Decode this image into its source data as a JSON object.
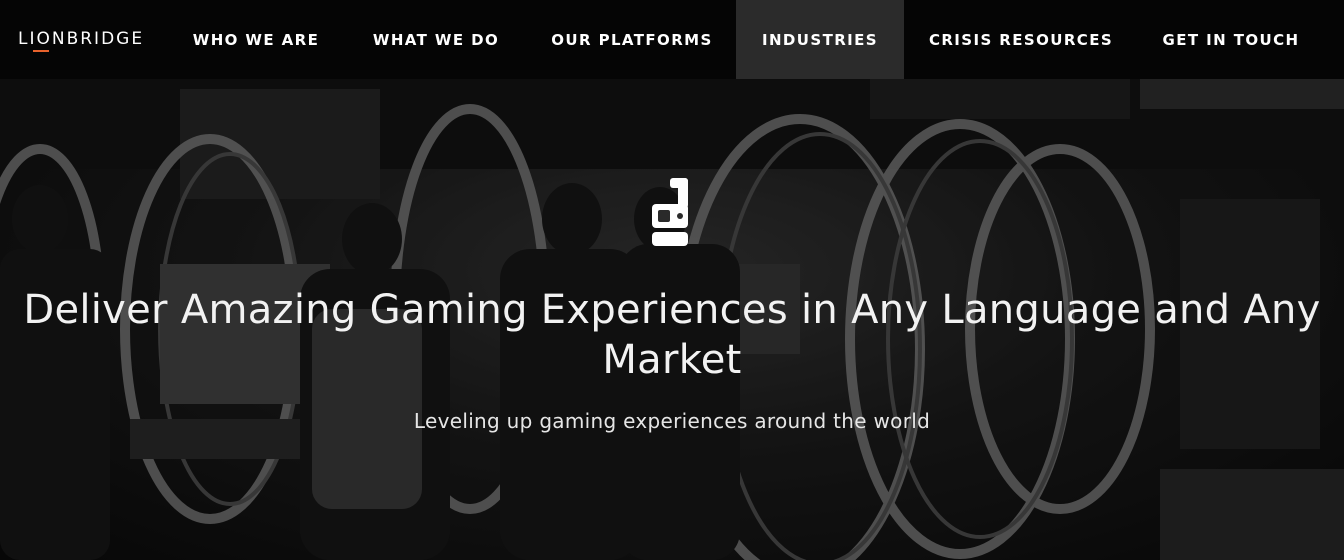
{
  "brand": {
    "logo_text": "LIONBRIDGE",
    "accent_color": "#e8622c"
  },
  "nav": {
    "items": [
      {
        "label": "WHO WE ARE"
      },
      {
        "label": "WHAT WE DO"
      },
      {
        "label": "OUR PLATFORMS"
      },
      {
        "label": "INDUSTRIES",
        "active": true
      },
      {
        "label": "CRISIS RESOURCES"
      },
      {
        "label": "GET IN TOUCH"
      }
    ],
    "active_bg": "#2b2b2b"
  },
  "hero": {
    "icon": "gaming-controller-icon",
    "headline": "Deliver Amazing Gaming Experiences in Any Language and Any Market",
    "subheadline": "Leveling up gaming experiences around the world",
    "background": "grayscale gaming expo photo"
  }
}
